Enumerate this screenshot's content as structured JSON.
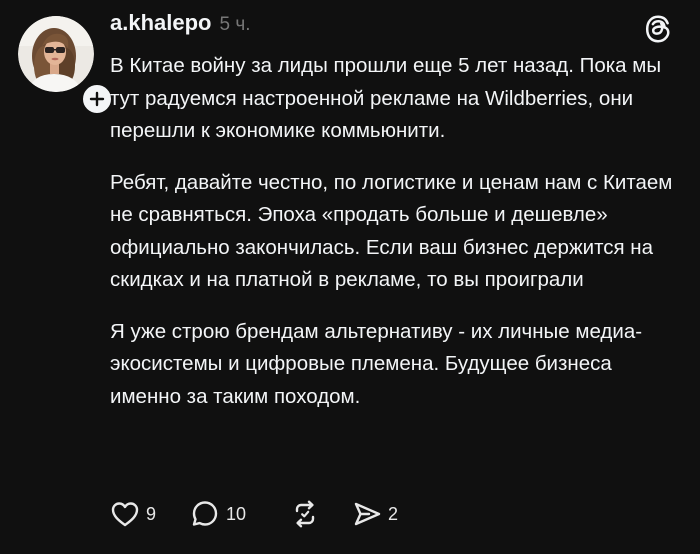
{
  "post": {
    "username": "a.khalepo",
    "time_ago": "5 ч.",
    "paragraphs": [
      "В Китае войну за лиды прошли еще 5 лет назад. Пока мы тут радуемся настроенной рекламе на Wildberries, они перешли к экономике коммьюнити.",
      "Ребят, давайте честно, по логистике и ценам нам с Китаем не сравняться. Эпоха «продать больше и дешевле» официально закончилась. Если ваш бизнес держится на скидках и на платной  в рекламе, то вы проиграли",
      "Я уже строю брендам альтернативу - их личные медиа-экосистемы и цифровые племена. Будущее бизнеса именно за таким походом."
    ],
    "likes": "9",
    "replies": "10",
    "shares": "2"
  },
  "icons": {
    "avatar": "avatar-photo",
    "follow": "plus-icon",
    "logo": "threads-logo-icon",
    "like": "heart-icon",
    "reply": "speech-bubble-icon",
    "repost": "repost-icon",
    "share": "send-icon"
  },
  "colors": {
    "background": "#101010",
    "text": "#f3f5f7",
    "secondary_text": "#777777"
  }
}
